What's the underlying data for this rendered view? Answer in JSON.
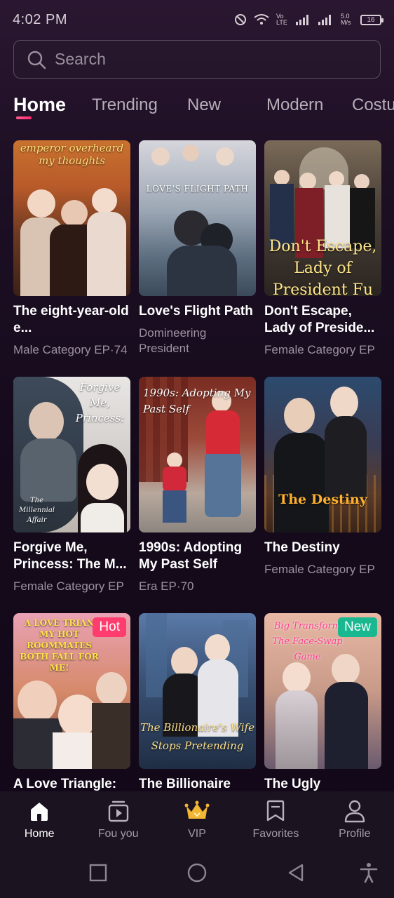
{
  "status_bar": {
    "time": "4:02 PM",
    "network_label": "Vo LTE",
    "speed": "5.0 M/s",
    "battery": "16"
  },
  "search": {
    "placeholder": "Search"
  },
  "tabs": [
    {
      "label": "Home",
      "active": true
    },
    {
      "label": "Trending",
      "active": false
    },
    {
      "label": "New",
      "active": false
    },
    {
      "label": "Modern",
      "active": false
    },
    {
      "label": "Costu",
      "active": false
    }
  ],
  "cards": [
    {
      "title": "The eight-year-old e...",
      "subtitle": "Male Category EP·74",
      "poster_text": "emperor overheard my thoughts",
      "badge": ""
    },
    {
      "title": "Love's Flight Path",
      "subtitle": "Domineering President",
      "poster_text": "LOVE'S FLIGHT PATH",
      "badge": ""
    },
    {
      "title": "Don't Escape, Lady of Preside...",
      "subtitle": "Female Category EP",
      "poster_text": "Don't Escape, Lady of President Fu",
      "badge": ""
    },
    {
      "title": "Forgive Me, Princess: The M...",
      "subtitle": "Female Category EP",
      "poster_text": "Forgive Me, Princess:",
      "poster_text2": "The Millennial Affair",
      "badge": ""
    },
    {
      "title": "1990s: Adopting My Past Self",
      "subtitle": "Era EP·70",
      "poster_text": "1990s: Adopting My Past Self",
      "badge": ""
    },
    {
      "title": "The Destiny",
      "subtitle": "Female Category EP",
      "poster_text": "The Destiny",
      "badge": ""
    },
    {
      "title": "A Love Triangle:",
      "subtitle": "",
      "poster_text": "A LOVE TRIAN MY HOT ROOMMATES BOTH FALL FOR ME!",
      "badge": "Hot"
    },
    {
      "title": "The Billionaire",
      "subtitle": "",
      "poster_text": "The Billionaire's Wife Stops Pretending",
      "badge": ""
    },
    {
      "title": "The Ugly",
      "subtitle": "",
      "poster_text": "Big Transform The Face-Swap Game",
      "badge": "New"
    }
  ],
  "bottom_nav": [
    {
      "label": "Home",
      "icon": "home-icon",
      "active": true
    },
    {
      "label": "Fou you",
      "icon": "video-icon",
      "active": false
    },
    {
      "label": "VIP",
      "icon": "crown-icon",
      "active": false
    },
    {
      "label": "Favorites",
      "icon": "bookmark-icon",
      "active": false
    },
    {
      "label": "Profile",
      "icon": "profile-icon",
      "active": false
    }
  ],
  "colors": {
    "accent": "#ff3c6e",
    "new_badge": "#19b890",
    "vip_gold": "#f2b632"
  }
}
